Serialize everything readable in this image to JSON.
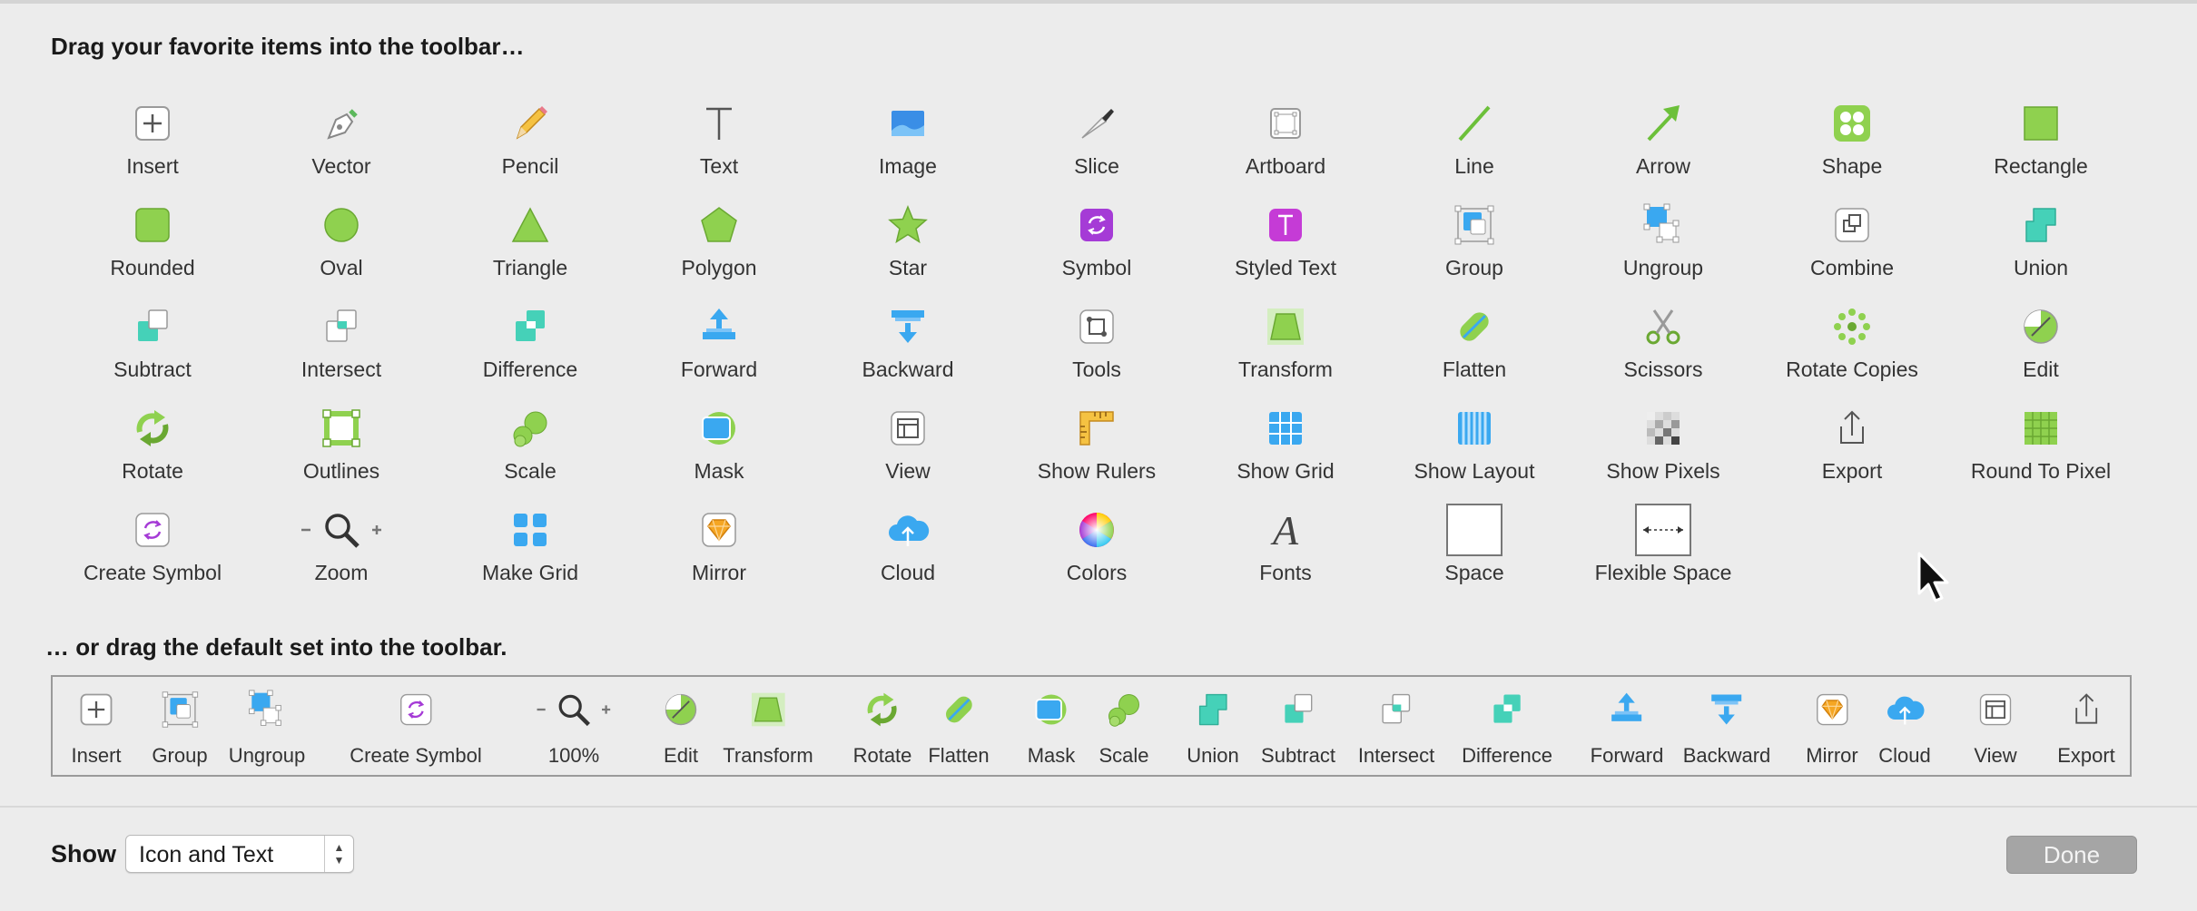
{
  "window": {
    "palette_heading": "Drag your favorite items into the toolbar…",
    "default_heading": "… or drag the default set into the toolbar."
  },
  "palette": [
    {
      "label": "Insert",
      "icon": "plus-box-icon"
    },
    {
      "label": "Vector",
      "icon": "pen-nib-icon"
    },
    {
      "label": "Pencil",
      "icon": "pencil-icon"
    },
    {
      "label": "Text",
      "icon": "text-t-icon"
    },
    {
      "label": "Image",
      "icon": "image-icon"
    },
    {
      "label": "Slice",
      "icon": "knife-icon"
    },
    {
      "label": "Artboard",
      "icon": "artboard-icon"
    },
    {
      "label": "Line",
      "icon": "line-icon"
    },
    {
      "label": "Arrow",
      "icon": "arrow-icon"
    },
    {
      "label": "Shape",
      "icon": "shape-icon"
    },
    {
      "label": "Rectangle",
      "icon": "rectangle-icon"
    },
    {
      "label": "Rounded",
      "icon": "rounded-rect-icon"
    },
    {
      "label": "Oval",
      "icon": "oval-icon"
    },
    {
      "label": "Triangle",
      "icon": "triangle-icon"
    },
    {
      "label": "Polygon",
      "icon": "polygon-icon"
    },
    {
      "label": "Star",
      "icon": "star-icon"
    },
    {
      "label": "Symbol",
      "icon": "symbol-icon"
    },
    {
      "label": "Styled Text",
      "icon": "styled-text-icon"
    },
    {
      "label": "Group",
      "icon": "group-icon"
    },
    {
      "label": "Ungroup",
      "icon": "ungroup-icon"
    },
    {
      "label": "Combine",
      "icon": "combine-icon"
    },
    {
      "label": "Union",
      "icon": "union-icon"
    },
    {
      "label": "Subtract",
      "icon": "subtract-icon"
    },
    {
      "label": "Intersect",
      "icon": "intersect-icon"
    },
    {
      "label": "Difference",
      "icon": "difference-icon"
    },
    {
      "label": "Forward",
      "icon": "forward-icon"
    },
    {
      "label": "Backward",
      "icon": "backward-icon"
    },
    {
      "label": "Tools",
      "icon": "tools-icon"
    },
    {
      "label": "Transform",
      "icon": "transform-icon"
    },
    {
      "label": "Flatten",
      "icon": "flatten-icon"
    },
    {
      "label": "Scissors",
      "icon": "scissors-icon"
    },
    {
      "label": "Rotate Copies",
      "icon": "rotate-copies-icon"
    },
    {
      "label": "Edit",
      "icon": "edit-icon"
    },
    {
      "label": "Rotate",
      "icon": "rotate-icon"
    },
    {
      "label": "Outlines",
      "icon": "outlines-icon"
    },
    {
      "label": "Scale",
      "icon": "scale-icon"
    },
    {
      "label": "Mask",
      "icon": "mask-icon"
    },
    {
      "label": "View",
      "icon": "view-icon"
    },
    {
      "label": "Show Rulers",
      "icon": "rulers-icon"
    },
    {
      "label": "Show Grid",
      "icon": "grid-icon"
    },
    {
      "label": "Show Layout",
      "icon": "layout-icon"
    },
    {
      "label": "Show Pixels",
      "icon": "pixels-icon"
    },
    {
      "label": "Export",
      "icon": "export-icon"
    },
    {
      "label": "Round To Pixel",
      "icon": "round-to-pixel-icon"
    },
    {
      "label": "Create Symbol",
      "icon": "create-symbol-icon"
    },
    {
      "label": "Zoom",
      "icon": "zoom-icon"
    },
    {
      "label": "Make Grid",
      "icon": "make-grid-icon"
    },
    {
      "label": "Mirror",
      "icon": "mirror-icon"
    },
    {
      "label": "Cloud",
      "icon": "cloud-icon"
    },
    {
      "label": "Colors",
      "icon": "colors-icon"
    },
    {
      "label": "Fonts",
      "icon": "fonts-icon"
    },
    {
      "label": "Space",
      "icon": "space-icon"
    },
    {
      "label": "Flexible Space",
      "icon": "flexible-space-icon"
    }
  ],
  "default_set": [
    {
      "label": "Insert",
      "icon": "plus-box-icon"
    },
    {
      "label": "Group",
      "icon": "group-icon"
    },
    {
      "label": "Ungroup",
      "icon": "ungroup-icon"
    },
    {
      "label": "Create Symbol",
      "icon": "create-symbol-icon"
    },
    {
      "label": "100%",
      "icon": "zoom-icon"
    },
    {
      "label": "Edit",
      "icon": "edit-icon"
    },
    {
      "label": "Transform",
      "icon": "transform-icon"
    },
    {
      "label": "Rotate",
      "icon": "rotate-icon"
    },
    {
      "label": "Flatten",
      "icon": "flatten-icon"
    },
    {
      "label": "Mask",
      "icon": "mask-icon"
    },
    {
      "label": "Scale",
      "icon": "scale-icon"
    },
    {
      "label": "Union",
      "icon": "union-icon"
    },
    {
      "label": "Subtract",
      "icon": "subtract-icon"
    },
    {
      "label": "Intersect",
      "icon": "intersect-icon"
    },
    {
      "label": "Difference",
      "icon": "difference-icon"
    },
    {
      "label": "Forward",
      "icon": "forward-icon"
    },
    {
      "label": "Backward",
      "icon": "backward-icon"
    },
    {
      "label": "Mirror",
      "icon": "mirror-icon"
    },
    {
      "label": "Cloud",
      "icon": "cloud-icon"
    },
    {
      "label": "View",
      "icon": "view-icon"
    },
    {
      "label": "Export",
      "icon": "export-icon"
    }
  ],
  "footer": {
    "show_label": "Show",
    "show_value": "Icon and Text",
    "done_label": "Done"
  },
  "colors": {
    "green": "#8fd14f",
    "teal": "#45d1b8",
    "blue": "#3aa8f0",
    "purple": "#a53bd6",
    "background": "#ececec"
  }
}
